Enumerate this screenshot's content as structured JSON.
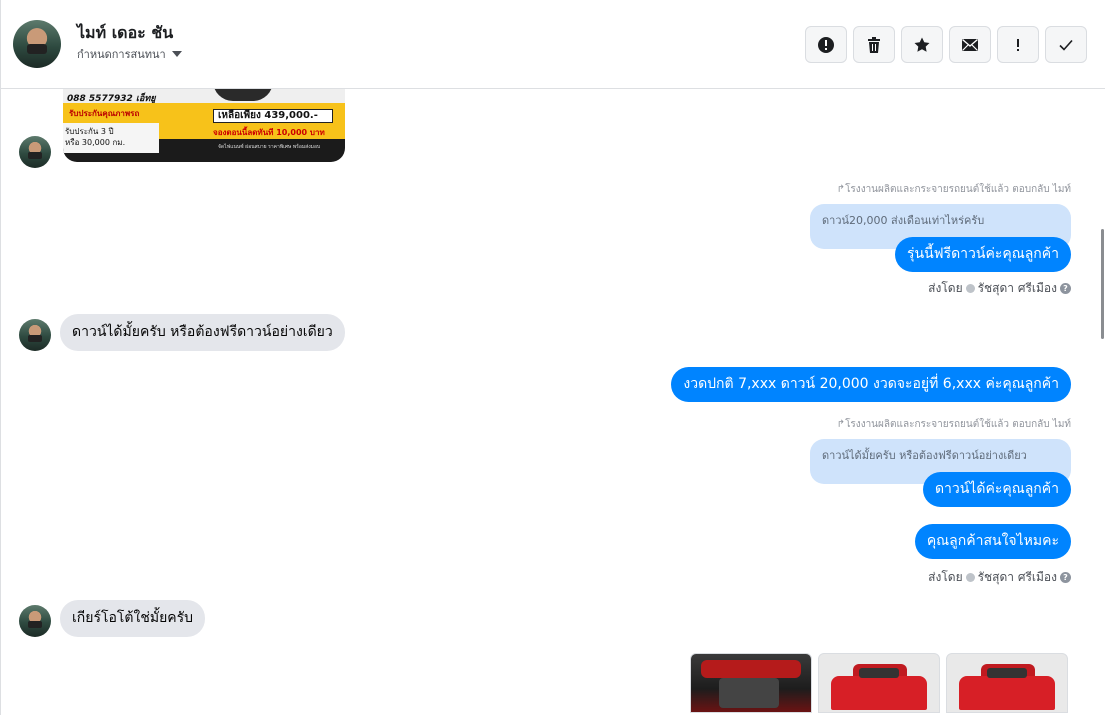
{
  "header": {
    "contact_name": "ไมท์ เดอะ ชัน",
    "conversation_settings": "กำหนดการสนทนา",
    "toolbar": [
      {
        "name": "report-spam-button",
        "icon": "alert-circle-icon"
      },
      {
        "name": "delete-button",
        "icon": "trash-icon"
      },
      {
        "name": "star-button",
        "icon": "star-icon"
      },
      {
        "name": "mark-unread-button",
        "icon": "envelope-icon"
      },
      {
        "name": "mark-important-button",
        "icon": "exclamation-icon"
      },
      {
        "name": "mark-done-button",
        "icon": "checkmark-icon"
      }
    ]
  },
  "ad_image": {
    "phone": "088 5577932 เอ็ทยู",
    "warranty": "รับประกันคุณภาพรถ",
    "price_label": "เหลือเพียง 439,000.-",
    "reserve": "จองตอนนี้ลดทันที 10,000 บาท",
    "guarantee_line1": "รับประกัน 3 ปี",
    "guarantee_line2": "หรือ 30,000 กม.",
    "footer": "จัดไฟแนนซ์ ผ่อนสบาย ราคาพิเศษ พร้อมส่งมอบ"
  },
  "messages": {
    "reply_note_1": "โรงงานผลิตและกระจายรถยนต์ใช้แล้ว ตอบกลับ ไมท์",
    "quote_1": "ดาวน์20,000 ส่งเดือนเท่าไหร่ครับ",
    "out_1": "รุ่นนี้ฟรีดาวน์ค่ะคุณลูกค้า",
    "sent_by_label_1": "ส่งโดย",
    "sent_by_name_1": "รัชสุดา ศรีเมือง",
    "in_1": "ดาวน์ได้มั้ยครับ หรือต้องฟรีดาวน์อย่างเดียว",
    "out_2": "งวดปกติ 7,xxx ดาวน์ 20,000 งวดจะอยู่ที่ 6,xxx ค่ะคุณลูกค้า",
    "reply_note_2": "โรงงานผลิตและกระจายรถยนต์ใช้แล้ว ตอบกลับ ไมท์",
    "quote_2": "ดาวน์ได้มั้ยครับ หรือต้องฟรีดาวน์อย่างเดียว",
    "out_3": "ดาวน์ได้ค่ะคุณลูกค้า",
    "out_4": "คุณลูกค้าสนใจไหมคะ",
    "sent_by_label_2": "ส่งโดย",
    "sent_by_name_2": "รัชสุดา ศรีเมือง",
    "in_2": "เกียร์โอโต้ใช่มั้ยครับ"
  },
  "colors": {
    "outgoing_bubble": "#0084ff",
    "incoming_bubble": "#e4e6eb",
    "quote_bubble": "#cfe3fb"
  }
}
